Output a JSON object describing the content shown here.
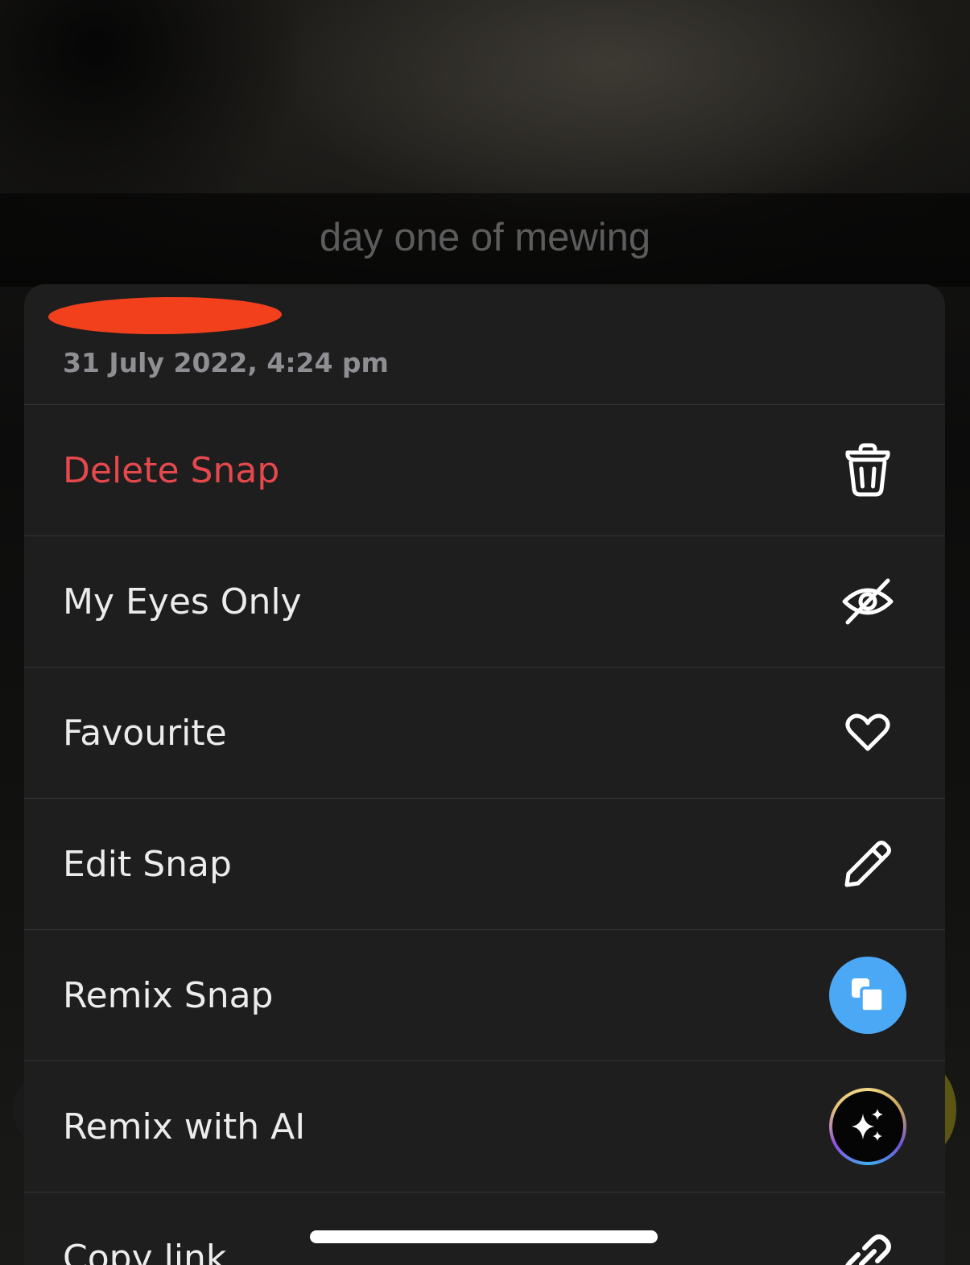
{
  "snap": {
    "caption": "day one of mewing",
    "sender": "********",
    "date": "31 July 2022, 4:24 pm"
  },
  "menu": {
    "items": [
      {
        "label": "Delete Snap",
        "icon": "trash-icon",
        "color": "#e5484d"
      },
      {
        "label": "My Eyes Only",
        "icon": "eye-slash-icon"
      },
      {
        "label": "Favourite",
        "icon": "heart-icon"
      },
      {
        "label": "Edit Snap",
        "icon": "pencil-icon"
      },
      {
        "label": "Remix Snap",
        "icon": "remix-icon",
        "color": "#4aa8f5"
      },
      {
        "label": "Remix with AI",
        "icon": "sparkles-icon"
      },
      {
        "label": "Copy link",
        "icon": "link-icon"
      }
    ]
  },
  "colors": {
    "sheet_background": "#1e1e1f",
    "danger": "#e5484d",
    "redaction": "#f2401d"
  }
}
